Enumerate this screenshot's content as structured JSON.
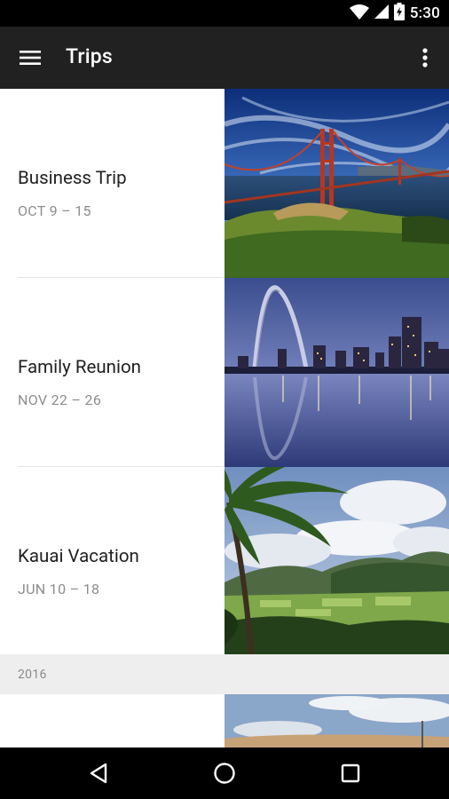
{
  "status_bar": {
    "time": "5:30",
    "icons": [
      "wifi-icon",
      "cell-signal-icon",
      "battery-icon"
    ]
  },
  "app_bar": {
    "title": "Trips",
    "menu_icon": "menu-icon",
    "more_icon": "more-vert-icon",
    "background": "#212121"
  },
  "trips": [
    {
      "name": "Business Trip",
      "dates": "OCT 9 – 15",
      "photo": "golden-gate-bridge"
    },
    {
      "name": "Family Reunion",
      "dates": "NOV 22 – 26",
      "photo": "st-louis-arch-skyline"
    },
    {
      "name": "Kauai Vacation",
      "dates": "JUN 10 – 18",
      "photo": "kauai-valley-palm"
    }
  ],
  "section_header": {
    "year": "2016"
  },
  "navigation_bar": {
    "icons": [
      "back-icon",
      "home-icon",
      "recents-icon"
    ]
  }
}
